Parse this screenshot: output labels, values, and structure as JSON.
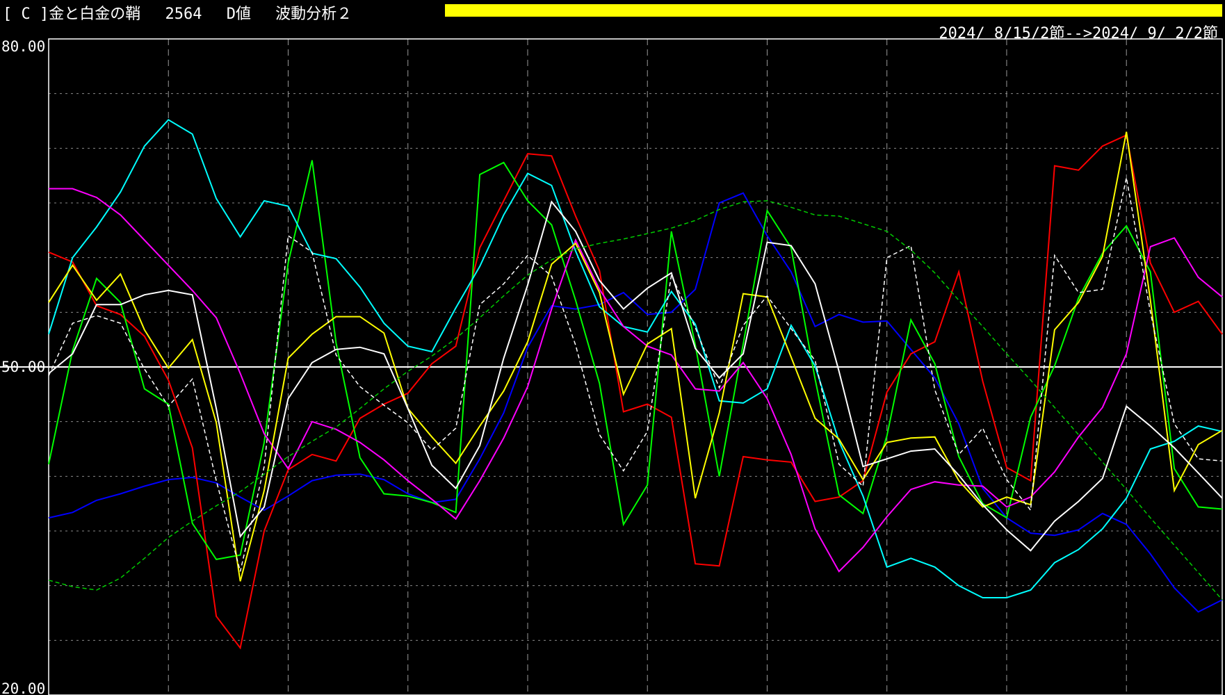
{
  "header": {
    "title": "[ C ]金と白金の鞘　 2564　 D値　 波動分析２",
    "bar_color": "#ffff00",
    "date_range": "2024/ 8/15/2節-->2024/ 9/ 2/2節"
  },
  "chart_data": {
    "type": "line",
    "title": "",
    "xlabel": "",
    "ylabel": "",
    "ylim": [
      20,
      80
    ],
    "y_tick_labels": [
      "80.00",
      "50.00",
      "20.00"
    ],
    "y_ticks": [
      80,
      50,
      20
    ],
    "midline": 50,
    "n_points": 50,
    "grid": true,
    "x": [
      0,
      1,
      2,
      3,
      4,
      5,
      6,
      7,
      8,
      9,
      10,
      11,
      12,
      13,
      14,
      15,
      16,
      17,
      18,
      19,
      20,
      21,
      22,
      23,
      24,
      25,
      26,
      27,
      28,
      29,
      30,
      31,
      32,
      33,
      34,
      35,
      36,
      37,
      38,
      39,
      40,
      41,
      42,
      43,
      44,
      45,
      46,
      47,
      48,
      49
    ],
    "series": [
      {
        "color": "#0000ff",
        "style": "solid",
        "values": [
          36.2,
          36.7,
          37.8,
          38.4,
          39.1,
          39.7,
          39.9,
          39.4,
          38.1,
          36.9,
          38.2,
          39.6,
          40.1,
          40.2,
          39.7,
          38.4,
          37.6,
          37.9,
          41.6,
          45.8,
          51.8,
          55.6,
          55.3,
          55.7,
          56.8,
          54.8,
          55.0,
          57.1,
          65.0,
          65.9,
          62.0,
          58.7,
          53.7,
          54.8,
          54.1,
          54.2,
          51.6,
          49.0,
          44.8,
          38.9,
          36.2,
          34.8,
          34.6,
          35.1,
          36.6,
          35.6,
          32.9,
          29.8,
          27.6,
          28.7
        ]
      },
      {
        "color": "#ff0000",
        "style": "solid",
        "values": [
          60.5,
          59.6,
          55.6,
          54.8,
          52.8,
          48.8,
          42.6,
          27.2,
          24.3,
          35.0,
          40.6,
          42.0,
          41.4,
          45.3,
          46.6,
          47.6,
          50.3,
          51.9,
          60.9,
          65.2,
          69.5,
          69.3,
          63.8,
          58.8,
          45.9,
          46.6,
          45.4,
          32.0,
          31.8,
          41.8,
          41.5,
          41.3,
          37.7,
          38.1,
          39.6,
          47.7,
          51.2,
          52.3,
          58.7,
          48.7,
          40.8,
          39.6,
          68.4,
          68.0,
          70.2,
          71.2,
          59.5,
          55.0,
          56.0,
          53.0
        ]
      },
      {
        "color": "#00ff00",
        "style": "solid",
        "values": [
          41.1,
          51.5,
          58.1,
          55.9,
          48.0,
          46.6,
          35.7,
          32.4,
          32.8,
          43.1,
          59.5,
          68.9,
          52.2,
          41.7,
          38.4,
          38.2,
          37.6,
          36.7,
          67.6,
          68.7,
          65.2,
          63.0,
          56.1,
          48.5,
          35.6,
          39.2,
          62.4,
          52.0,
          40.0,
          52.1,
          64.3,
          60.9,
          48.9,
          38.3,
          36.6,
          43.7,
          54.3,
          50.3,
          41.8,
          37.5,
          36.2,
          45.4,
          50.1,
          56.3,
          60.4,
          62.9,
          58.7,
          40.7,
          37.2,
          37.0
        ]
      },
      {
        "color": "#00ffff",
        "style": "solid",
        "values": [
          53.0,
          60.0,
          62.8,
          66.0,
          70.2,
          72.6,
          71.3,
          65.4,
          61.9,
          65.2,
          64.7,
          60.4,
          59.9,
          57.3,
          54.0,
          51.9,
          51.4,
          55.4,
          59.2,
          63.9,
          67.7,
          66.6,
          60.6,
          55.5,
          53.7,
          53.2,
          56.9,
          53.9,
          46.9,
          46.7,
          48.0,
          53.8,
          50.1,
          43.2,
          38.2,
          31.7,
          32.5,
          31.7,
          30.0,
          28.9,
          28.9,
          29.6,
          32.1,
          33.3,
          35.2,
          38.0,
          42.5,
          43.2,
          44.6,
          44.1
        ]
      },
      {
        "color": "#ff00ff",
        "style": "solid",
        "values": [
          66.3,
          66.3,
          65.5,
          63.9,
          61.6,
          59.3,
          57.0,
          54.5,
          49.4,
          43.9,
          40.7,
          45.0,
          44.3,
          43.1,
          41.5,
          39.6,
          37.9,
          36.1,
          39.6,
          43.5,
          48.2,
          55.3,
          61.6,
          57.1,
          53.7,
          51.9,
          51.1,
          48.0,
          47.8,
          50.4,
          47.1,
          42.0,
          35.2,
          31.3,
          33.5,
          36.3,
          38.8,
          39.5,
          39.2,
          39.1,
          37.2,
          38.1,
          40.4,
          43.6,
          46.3,
          51.2,
          61.0,
          61.8,
          58.2,
          56.4
        ]
      },
      {
        "color": "#ffff00",
        "style": "solid",
        "values": [
          55.9,
          59.3,
          56.1,
          58.5,
          53.4,
          49.9,
          52.5,
          44.9,
          30.4,
          38.7,
          50.8,
          53.0,
          54.6,
          54.6,
          53.1,
          46.2,
          43.6,
          41.2,
          44.6,
          47.8,
          52.3,
          59.4,
          61.3,
          56.8,
          47.5,
          52.1,
          53.5,
          38.0,
          45.8,
          56.7,
          56.4,
          50.9,
          45.3,
          43.4,
          39.7,
          43.1,
          43.5,
          43.6,
          39.6,
          37.2,
          38.1,
          37.4,
          53.4,
          55.9,
          60.1,
          71.5,
          56.1,
          38.7,
          42.9,
          44.2
        ]
      },
      {
        "color": "#ffffff",
        "style": "solid",
        "values": [
          49.4,
          51.2,
          55.7,
          55.7,
          56.6,
          57.0,
          56.6,
          46.2,
          34.5,
          37.2,
          47.1,
          50.4,
          51.6,
          51.8,
          51.2,
          46.2,
          41.0,
          38.9,
          42.8,
          50.8,
          57.5,
          65.1,
          62.4,
          57.9,
          55.3,
          57.2,
          58.6,
          51.7,
          49.0,
          51.2,
          61.4,
          61.1,
          57.6,
          49.6,
          40.9,
          41.6,
          42.3,
          42.5,
          40.1,
          37.4,
          35.1,
          33.2,
          35.9,
          37.7,
          39.8,
          46.4,
          44.6,
          42.6,
          40.3,
          38.0
        ]
      },
      {
        "color": "#ffffff",
        "style": "dashed",
        "values": [
          49.2,
          54.0,
          54.7,
          54.0,
          49.8,
          46.4,
          48.9,
          39.6,
          31.3,
          40.9,
          62.0,
          60.5,
          51.1,
          48.2,
          46.5,
          44.9,
          42.4,
          44.4,
          55.7,
          57.6,
          60.2,
          58.3,
          52.0,
          43.8,
          40.5,
          44.1,
          58.4,
          53.6,
          48.1,
          53.8,
          56.5,
          53.5,
          50.6,
          41.1,
          39.1,
          60.0,
          61.1,
          47.9,
          42.0,
          44.4,
          39.7,
          36.9,
          60.2,
          56.8,
          57.1,
          67.3,
          55.0,
          44.8,
          41.6,
          41.4
        ]
      },
      {
        "color": "#00cc00",
        "style": "dashed",
        "values": [
          30.5,
          29.9,
          29.6,
          30.7,
          32.5,
          34.4,
          35.9,
          37.3,
          38.6,
          40.2,
          41.8,
          43.2,
          44.5,
          46.2,
          48.0,
          49.6,
          51.0,
          52.6,
          54.5,
          56.5,
          58.4,
          59.8,
          60.8,
          61.3,
          61.7,
          62.2,
          62.7,
          63.4,
          64.4,
          65.1,
          65.2,
          64.6,
          63.9,
          63.8,
          63.1,
          62.4,
          60.7,
          58.6,
          56.1,
          53.7,
          51.2,
          48.8,
          46.3,
          43.8,
          41.3,
          38.8,
          36.2,
          33.7,
          31.2,
          28.7
        ]
      }
    ]
  }
}
